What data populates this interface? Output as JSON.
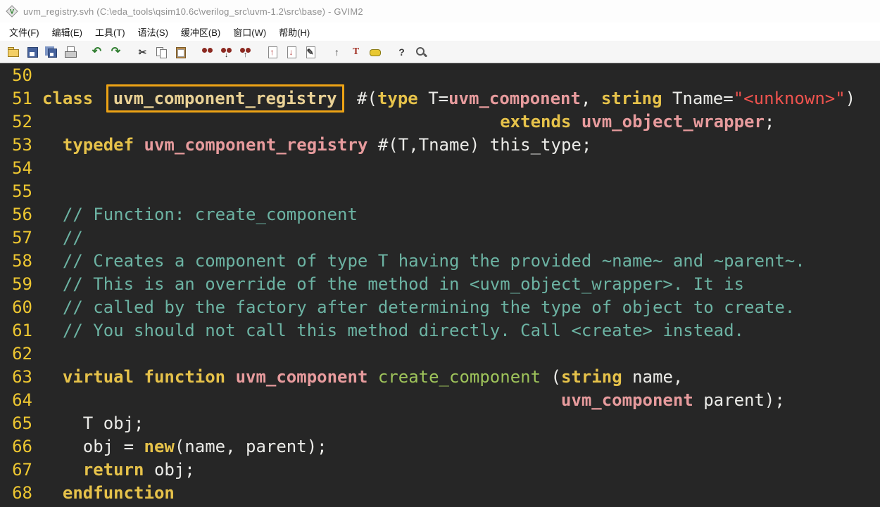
{
  "window": {
    "title": "uvm_registry.svh (C:\\eda_tools\\qsim10.6c\\verilog_src\\uvm-1.2\\src\\base) - GVIM2"
  },
  "menu": {
    "items": [
      {
        "name": "menu-file",
        "label": "文件(F)"
      },
      {
        "name": "menu-edit",
        "label": "编辑(E)"
      },
      {
        "name": "menu-tools",
        "label": "工具(T)"
      },
      {
        "name": "menu-syntax",
        "label": "语法(S)"
      },
      {
        "name": "menu-buffers",
        "label": "缓冲区(B)"
      },
      {
        "name": "menu-window",
        "label": "窗口(W)"
      },
      {
        "name": "menu-help",
        "label": "帮助(H)"
      }
    ]
  },
  "toolbar": {
    "groups": [
      [
        {
          "id": "open-file",
          "kind": "folder",
          "glyph": ""
        },
        {
          "id": "save-file",
          "kind": "floppy",
          "glyph": ""
        },
        {
          "id": "save-all",
          "kind": "floppies",
          "glyph": ""
        },
        {
          "id": "print",
          "kind": "printer",
          "glyph": ""
        }
      ],
      [
        {
          "id": "undo",
          "kind": "glyph-green",
          "glyph": "↶"
        },
        {
          "id": "redo",
          "kind": "glyph-green",
          "glyph": "↷"
        }
      ],
      [
        {
          "id": "cut",
          "kind": "glyph-dark",
          "glyph": "✂"
        },
        {
          "id": "copy",
          "kind": "copy",
          "glyph": ""
        },
        {
          "id": "paste",
          "kind": "paste",
          "glyph": ""
        }
      ],
      [
        {
          "id": "find-replace",
          "kind": "bino",
          "glyph": ""
        },
        {
          "id": "find-next",
          "kind": "bino",
          "glyph": "↓"
        },
        {
          "id": "find-prev",
          "kind": "bino",
          "glyph": "↑"
        }
      ],
      [
        {
          "id": "load-session",
          "kind": "page-red",
          "glyph": "↑"
        },
        {
          "id": "save-session",
          "kind": "page-red",
          "glyph": "↓"
        },
        {
          "id": "run-script",
          "kind": "page-dark",
          "glyph": "✎"
        }
      ],
      [
        {
          "id": "make",
          "kind": "glyph-dark",
          "glyph": "↑"
        },
        {
          "id": "run-ctags",
          "kind": "glyph-red",
          "glyph": "T"
        },
        {
          "id": "tag-jump",
          "kind": "tag",
          "glyph": ""
        }
      ],
      [
        {
          "id": "help",
          "kind": "glyph-dark",
          "glyph": "?"
        },
        {
          "id": "find-help",
          "kind": "mag",
          "glyph": ""
        }
      ]
    ]
  },
  "editor": {
    "colors": {
      "editor_bg": "#262626",
      "line_number": "#eec731",
      "keyword": "#e6c24a",
      "type_name": "#e79b9d",
      "function_name": "#9ec35a",
      "comment": "#6cb3a3",
      "string": "#ef534e",
      "text": "#ebebe8",
      "highlight_box": "#eda315"
    },
    "lines": [
      {
        "num": "50",
        "tokens": []
      },
      {
        "num": "51",
        "tokens": [
          [
            "kw",
            "class "
          ],
          [
            "boxed",
            "uvm_component_registry"
          ],
          [
            "pln",
            " #("
          ],
          [
            "kw",
            "type"
          ],
          [
            "pln",
            " T="
          ],
          [
            "typ",
            "uvm_component"
          ],
          [
            "pln",
            ", "
          ],
          [
            "kw",
            "string"
          ],
          [
            "pln",
            " Tname="
          ],
          [
            "str",
            "\"<unknown>\""
          ],
          [
            "pln",
            ")"
          ]
        ]
      },
      {
        "num": "52",
        "tokens": [
          [
            "pln",
            "                                             "
          ],
          [
            "kw",
            "extends"
          ],
          [
            "pln",
            " "
          ],
          [
            "typ",
            "uvm_object_wrapper"
          ],
          [
            "pln",
            ";"
          ]
        ]
      },
      {
        "num": "53",
        "tokens": [
          [
            "pln",
            "  "
          ],
          [
            "kw",
            "typedef"
          ],
          [
            "pln",
            " "
          ],
          [
            "typ",
            "uvm_component_registry"
          ],
          [
            "pln",
            " #(T,Tname) this_type;"
          ]
        ]
      },
      {
        "num": "54",
        "tokens": []
      },
      {
        "num": "55",
        "tokens": []
      },
      {
        "num": "56",
        "tokens": [
          [
            "pln",
            "  "
          ],
          [
            "com",
            "// Function: create_component"
          ]
        ]
      },
      {
        "num": "57",
        "tokens": [
          [
            "pln",
            "  "
          ],
          [
            "com",
            "//"
          ]
        ]
      },
      {
        "num": "58",
        "tokens": [
          [
            "pln",
            "  "
          ],
          [
            "com",
            "// Creates a component of type T having the provided ~name~ and ~parent~."
          ]
        ]
      },
      {
        "num": "59",
        "tokens": [
          [
            "pln",
            "  "
          ],
          [
            "com",
            "// This is an override of the method in <uvm_object_wrapper>. It is"
          ]
        ]
      },
      {
        "num": "60",
        "tokens": [
          [
            "pln",
            "  "
          ],
          [
            "com",
            "// called by the factory after determining the type of object to create."
          ]
        ]
      },
      {
        "num": "61",
        "tokens": [
          [
            "pln",
            "  "
          ],
          [
            "com",
            "// You should not call this method directly. Call <create> instead."
          ]
        ]
      },
      {
        "num": "62",
        "tokens": []
      },
      {
        "num": "63",
        "tokens": [
          [
            "pln",
            "  "
          ],
          [
            "kw",
            "virtual"
          ],
          [
            "pln",
            " "
          ],
          [
            "kw",
            "function"
          ],
          [
            "pln",
            " "
          ],
          [
            "typ",
            "uvm_component"
          ],
          [
            "pln",
            " "
          ],
          [
            "fn",
            "create_component"
          ],
          [
            "pln",
            " ("
          ],
          [
            "kw",
            "string"
          ],
          [
            "pln",
            " name,"
          ]
        ]
      },
      {
        "num": "64",
        "tokens": [
          [
            "pln",
            "                                                   "
          ],
          [
            "typ",
            "uvm_component"
          ],
          [
            "pln",
            " parent);"
          ]
        ]
      },
      {
        "num": "65",
        "tokens": [
          [
            "pln",
            "    T obj;"
          ]
        ]
      },
      {
        "num": "66",
        "tokens": [
          [
            "pln",
            "    obj = "
          ],
          [
            "kw",
            "new"
          ],
          [
            "pln",
            "(name, parent);"
          ]
        ]
      },
      {
        "num": "67",
        "tokens": [
          [
            "pln",
            "    "
          ],
          [
            "kw",
            "return"
          ],
          [
            "pln",
            " obj;"
          ]
        ]
      },
      {
        "num": "68",
        "tokens": [
          [
            "pln",
            "  "
          ],
          [
            "kw",
            "endfunction"
          ]
        ]
      }
    ]
  }
}
